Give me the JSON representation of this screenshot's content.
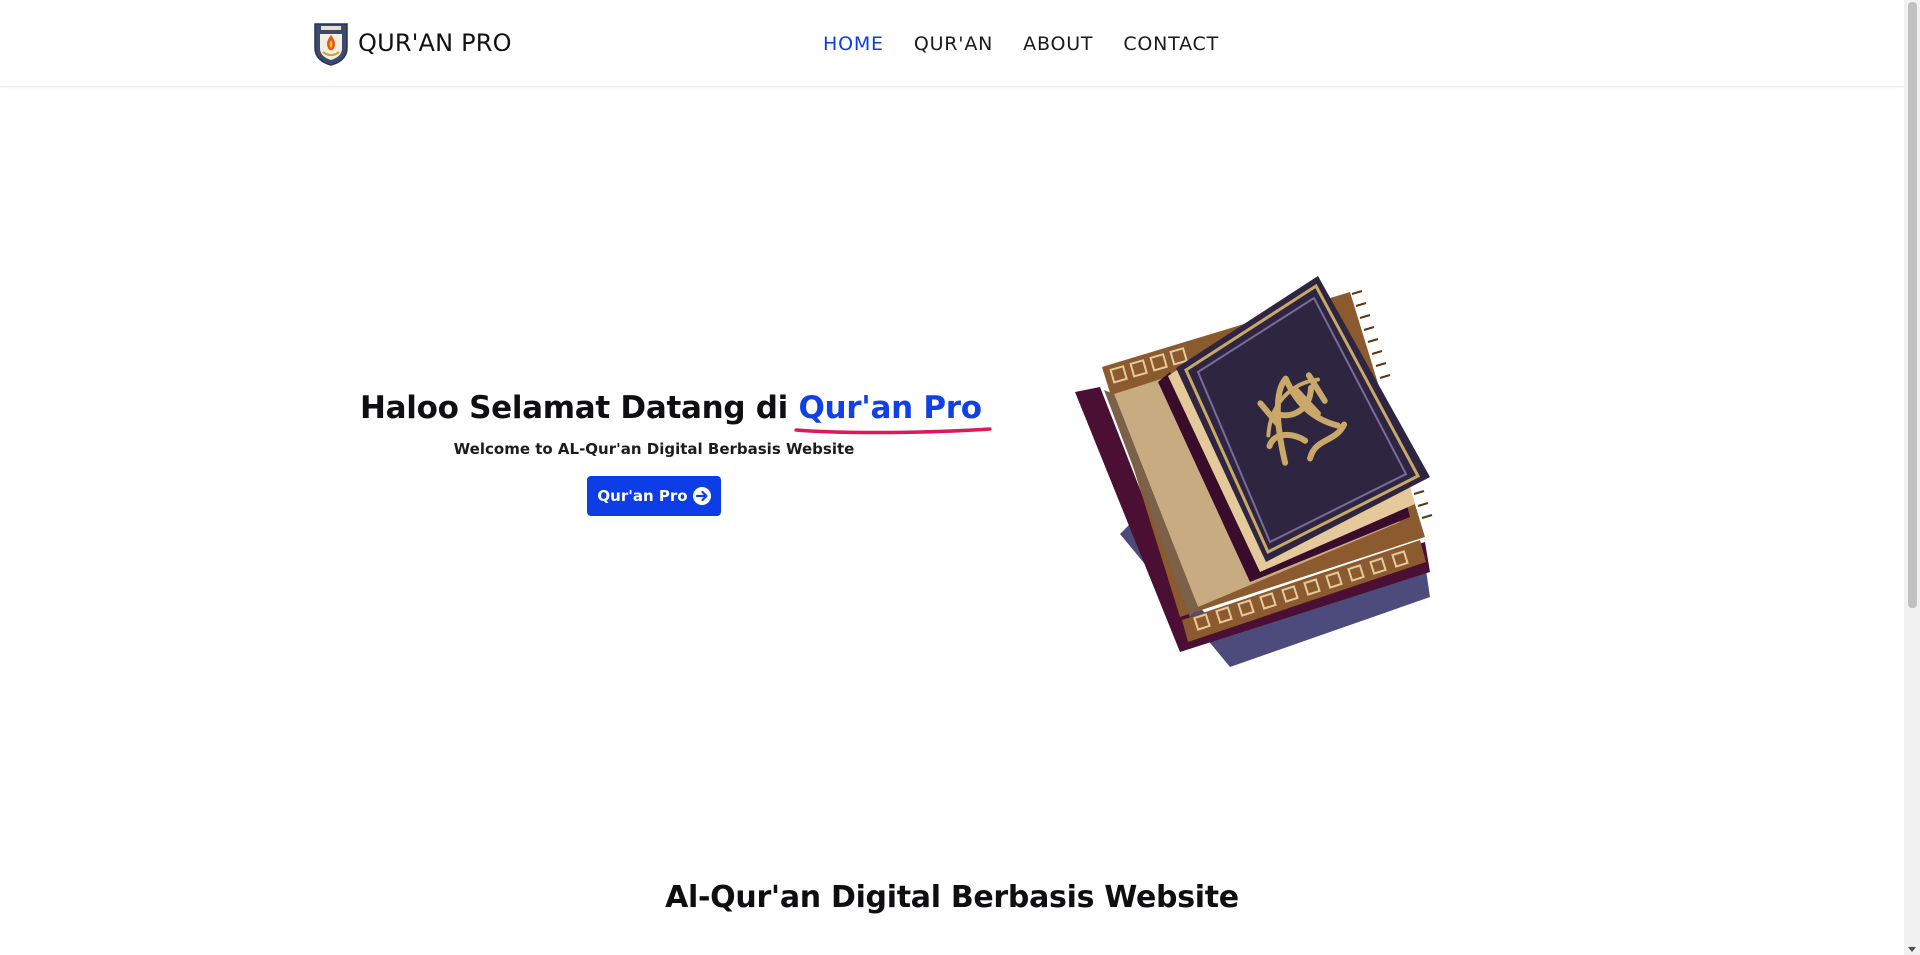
{
  "header": {
    "brand_name": "QUR'AN PRO",
    "logo_icon": "school-emblem-icon",
    "nav": [
      {
        "label": "HOME",
        "active": true
      },
      {
        "label": "QUR'AN",
        "active": false
      },
      {
        "label": "ABOUT",
        "active": false
      },
      {
        "label": "CONTACT",
        "active": false
      }
    ]
  },
  "hero": {
    "title_prefix": "Haloo Selamat Datang di",
    "title_highlight": "Qur'an Pro",
    "subtitle": "Welcome to AL-Qur'an Digital Berbasis Website",
    "button_label": "Qur'an Pro",
    "button_icon": "arrow-right-circle-icon",
    "illustration": "quran-book-icon"
  },
  "section": {
    "title": "Al-Qur'an Digital Berbasis Website"
  },
  "colors": {
    "accent": "#0d3de6",
    "underline": "#e0185a",
    "text": "#0f0f12",
    "book_cover": "#2e2640",
    "book_gold": "#c9a86a",
    "book_leather": "#8b5a2e",
    "book_page": "#c9ab82",
    "book_back": "#4a0f33"
  }
}
